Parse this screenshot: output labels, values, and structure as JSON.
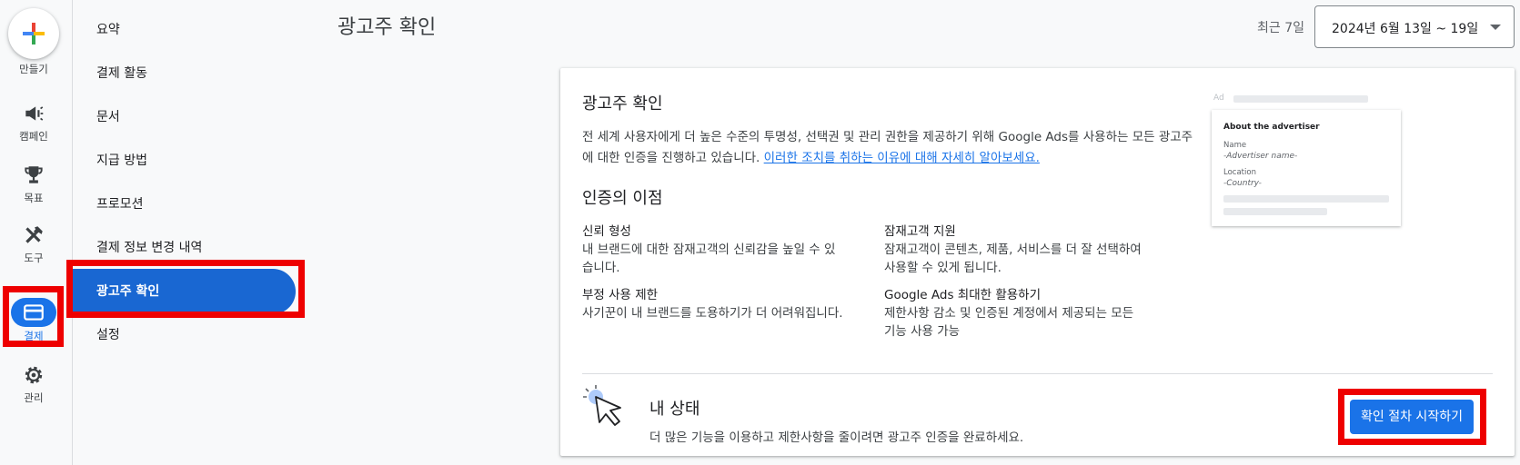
{
  "rail": {
    "create_label": "만들기",
    "items": [
      {
        "label": "캠페인",
        "icon": "megaphone-icon"
      },
      {
        "label": "목표",
        "icon": "trophy-icon"
      },
      {
        "label": "도구",
        "icon": "tools-icon"
      },
      {
        "label": "결제",
        "icon": "credit-card-icon"
      },
      {
        "label": "관리",
        "icon": "gear-icon"
      }
    ]
  },
  "subnav": {
    "items": [
      {
        "label": "요약"
      },
      {
        "label": "결제 활동"
      },
      {
        "label": "문서"
      },
      {
        "label": "지급 방법"
      },
      {
        "label": "프로모션"
      },
      {
        "label": "결제 정보 변경 내역"
      },
      {
        "label": "광고주 확인"
      },
      {
        "label": "설정"
      }
    ]
  },
  "header": {
    "title": "광고주 확인",
    "range_label": "최근 7일",
    "date_range": "2024년 6월 13일 ~ 19일"
  },
  "card": {
    "title": "광고주 확인",
    "desc_text": "전 세계 사용자에게 더 높은 수준의 투명성, 선택권 및 관리 권한을 제공하기 위해 Google Ads를 사용하는 모든 광고주에 대한 인증을 진행하고 있습니다. ",
    "desc_link": "이러한 조치를 취하는 이유에 대해 자세히 알아보세요.",
    "benefits_title": "인증의 이점",
    "benefits": [
      {
        "title": "신뢰 형성",
        "text": "내 브랜드에 대한 잠재고객의 신뢰감을 높일 수 있습니다."
      },
      {
        "title": "잠재고객 지원",
        "text": "잠재고객이 콘텐츠, 제품, 서비스를 더 잘 선택하여 사용할 수 있게 됩니다."
      },
      {
        "title": "부정 사용 제한",
        "text": "사기꾼이 내 브랜드를 도용하기가 더 어려워집니다."
      },
      {
        "title": "Google Ads 최대한 활용하기",
        "text": "제한사항 감소 및 인증된 계정에서 제공되는 모든 기능 사용 가능"
      }
    ],
    "status_title": "내 상태",
    "status_desc": "더 많은 기능을 이용하고 제한사항을 줄이려면 광고주 인증을 완료하세요.",
    "start_button": "확인 절차 시작하기"
  },
  "preview": {
    "ad_tag": "Ad",
    "card_title": "About the advertiser",
    "name_label": "Name",
    "name_value": "-Advertiser name-",
    "location_label": "Location",
    "location_value": "-Country-"
  },
  "colors": {
    "accent": "#1a73e8",
    "highlight": "#ee0000"
  }
}
